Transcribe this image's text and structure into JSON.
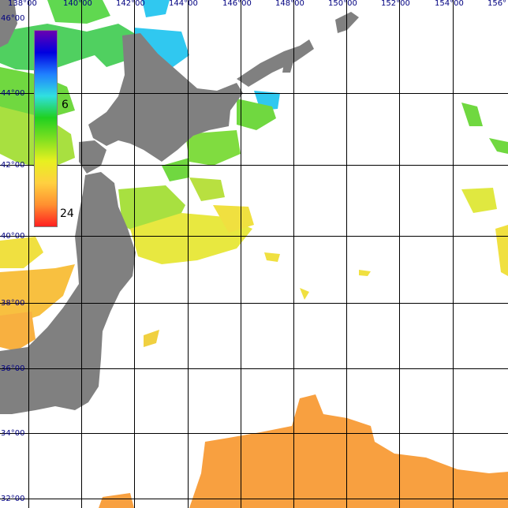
{
  "map": {
    "longitude_labels": [
      "138°00",
      "140°00",
      "142°00",
      "144°00",
      "146°00",
      "148°00",
      "150°00",
      "152°00",
      "154°00",
      "156°"
    ],
    "latitude_labels": [
      "46°00",
      "44°00",
      "42°00",
      "40°00",
      "38°00",
      "36°00",
      "34°00",
      "32°00"
    ],
    "legend": {
      "labels": [
        "6",
        "24"
      ],
      "gradient": [
        "#6a00b0",
        "#0000e0",
        "#2080ff",
        "#30e0e0",
        "#20d020",
        "#80e020",
        "#e8f020",
        "#ffd040",
        "#ff9030",
        "#ff2020"
      ]
    },
    "colors": {
      "land": "#808080",
      "grid": "#000000",
      "label": "#000080",
      "sst_cold": "#30c0f0",
      "sst_cool": "#40d040",
      "sst_mild": "#b8e040",
      "sst_warm": "#f0e040",
      "sst_hot": "#f8a040"
    }
  }
}
